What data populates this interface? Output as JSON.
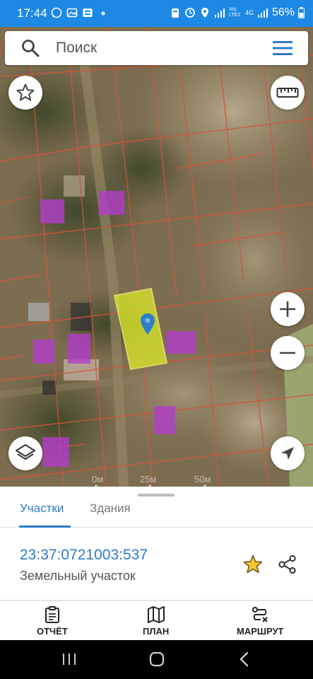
{
  "status_bar": {
    "time": "17:44",
    "network_label": "Vo) LTE2",
    "network_type": "4G",
    "battery": "56%"
  },
  "search": {
    "placeholder": "Поиск"
  },
  "map": {
    "scale_labels": [
      "0м",
      "25м",
      "50м"
    ],
    "colors": {
      "parcel_border": "#d2553c",
      "building_fill": "#b43ccc",
      "selected_fill": "#d8e62a",
      "marker": "#2f7ec8"
    }
  },
  "sheet": {
    "tabs": [
      {
        "label": "Участки",
        "active": true
      },
      {
        "label": "Здания",
        "active": false
      }
    ],
    "cadastral_number": "23:37:0721003:537",
    "object_type": "Земельный участок"
  },
  "bottom_nav": [
    {
      "label": "ОТЧЁТ",
      "icon": "report-icon"
    },
    {
      "label": "ПЛАН",
      "icon": "map-plan-icon"
    },
    {
      "label": "МАРШРУТ",
      "icon": "route-icon"
    }
  ],
  "colors": {
    "accent": "#2c7cc8",
    "status_bar": "#1e88e5"
  }
}
